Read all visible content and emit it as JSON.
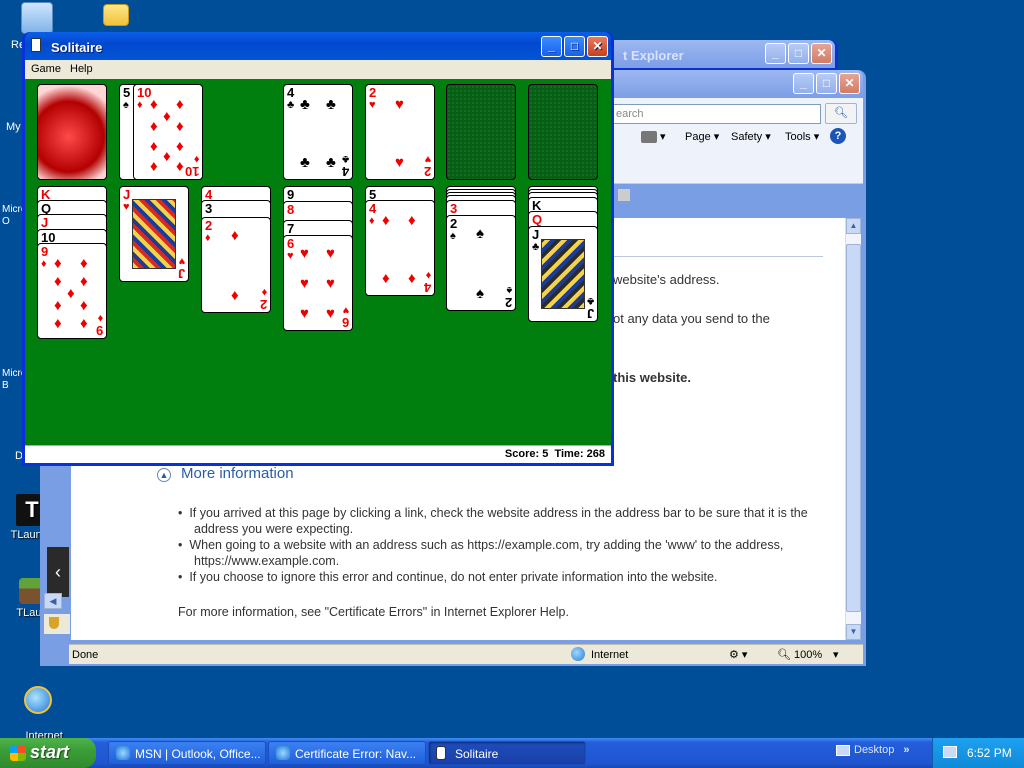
{
  "desktop": {
    "icons": [
      {
        "label": "Re",
        "icon": "recycle-bin-icon"
      },
      {
        "label": "",
        "icon": "folder-icon"
      },
      {
        "label": "My",
        "icon": "my-documents-icon"
      },
      {
        "label": "Micro\nO",
        "icon": "office-icon"
      },
      {
        "label": "Micro\nB",
        "icon": "office-icon"
      },
      {
        "label": "D",
        "icon": "document-icon"
      },
      {
        "label": "TLaunch",
        "icon": "tlauncher-icon"
      },
      {
        "label": "TLaun",
        "icon": "minecraft-icon"
      },
      {
        "label": "Internet\nExplorer",
        "icon": "internet-explorer-icon"
      }
    ]
  },
  "ie_back": {
    "title": "t Explorer"
  },
  "ie_front": {
    "search_placeholder": "earch",
    "toolbar": {
      "page": "Page",
      "safety": "Safety",
      "tools": "Tools"
    },
    "fragments": {
      "line1": "website's address.",
      "line2": "ot any data you send to the",
      "line3": "this website."
    },
    "more_info": "More information",
    "bullets": [
      "If you arrived at this page by clicking a link, check the website address in the address bar to be sure that it is the address you were expecting.",
      "When going to a website with an address such as https://example.com, try adding the 'www' to the address, https://www.example.com.",
      "If you choose to ignore this error and continue, do not enter private information into the website."
    ],
    "footer_text": "For more information, see \"Certificate Errors\" in Internet Explorer Help.",
    "status": {
      "left": "Done",
      "zone": "Internet",
      "zoom": "100%"
    }
  },
  "solitaire": {
    "title": "Solitaire",
    "menu": {
      "game": "Game",
      "help": "Help"
    },
    "status": "Score: 5  Time: 268",
    "colors": {
      "felt": "#007f0e"
    }
  },
  "taskbar": {
    "start": "start",
    "tasks": [
      {
        "label": "MSN | Outlook, Office...",
        "icon": "ie-icon"
      },
      {
        "label": "Certificate Error: Nav...",
        "icon": "ie-icon"
      },
      {
        "label": "Solitaire",
        "icon": "solitaire-icon"
      }
    ],
    "desktop_label": "Desktop",
    "chevron": "»",
    "clock": "6:52 PM"
  }
}
